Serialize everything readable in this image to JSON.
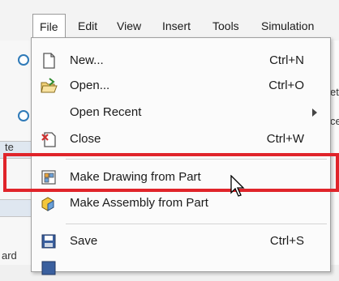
{
  "menubar": {
    "items": [
      {
        "label": "File",
        "active": true
      },
      {
        "label": "Edit"
      },
      {
        "label": "View"
      },
      {
        "label": "Insert"
      },
      {
        "label": "Tools"
      },
      {
        "label": "Simulation"
      }
    ]
  },
  "background": {
    "right_fragment_1": "et",
    "right_fragment_2": "ce",
    "left_fragment_1": "te",
    "left_fragment_2": "ard"
  },
  "file_menu": {
    "items": [
      {
        "label": "New...",
        "shortcut": "Ctrl+N",
        "icon": "new-document-icon"
      },
      {
        "label": "Open...",
        "shortcut": "Ctrl+O",
        "icon": "open-folder-icon"
      },
      {
        "label": "Open Recent",
        "shortcut": "",
        "icon": "",
        "submenu": true
      },
      {
        "label": "Close",
        "shortcut": "Ctrl+W",
        "icon": "close-document-icon"
      },
      {
        "label": "Make Drawing from Part",
        "shortcut": "",
        "icon": "make-drawing-icon"
      },
      {
        "label": "Make Assembly from Part",
        "shortcut": "",
        "icon": "make-assembly-icon"
      },
      {
        "label": "Save",
        "shortcut": "Ctrl+S",
        "icon": "save-icon"
      }
    ]
  },
  "colors": {
    "highlight_border": "#e0242a",
    "menu_background": "#fbfbfb"
  }
}
